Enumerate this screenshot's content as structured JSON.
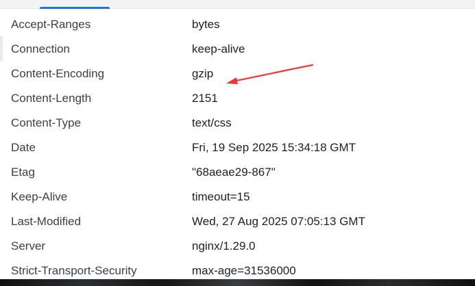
{
  "headers": [
    {
      "name": "Accept-Ranges",
      "value": "bytes"
    },
    {
      "name": "Connection",
      "value": "keep-alive"
    },
    {
      "name": "Content-Encoding",
      "value": "gzip"
    },
    {
      "name": "Content-Length",
      "value": "2151"
    },
    {
      "name": "Content-Type",
      "value": "text/css"
    },
    {
      "name": "Date",
      "value": "Fri, 19 Sep 2025 15:34:18 GMT"
    },
    {
      "name": "Etag",
      "value": "\"68aeae29-867\""
    },
    {
      "name": "Keep-Alive",
      "value": "timeout=15"
    },
    {
      "name": "Last-Modified",
      "value": "Wed, 27 Aug 2025 07:05:13 GMT"
    },
    {
      "name": "Server",
      "value": "nginx/1.29.0"
    },
    {
      "name": "Strict-Transport-Security",
      "value": "max-age=31536000"
    }
  ],
  "colors": {
    "accent": "#1a73e8",
    "annotation": "#e53935"
  }
}
